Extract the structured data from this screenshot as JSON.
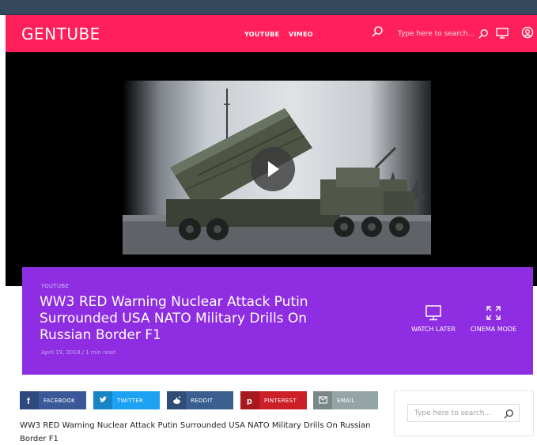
{
  "header": {
    "brand": "GENTUBE",
    "nav": [
      "YOUTUBE",
      "VIMEO"
    ],
    "search_placeholder": "Type here to search...",
    "icons": [
      "search-icon",
      "monitor-icon",
      "user-icon"
    ],
    "bg_color": "#ff1f5a"
  },
  "video": {
    "play_icon": "play-icon"
  },
  "info": {
    "category": "YOUTUBE",
    "title": "WW3 RED Warning Nuclear Attack Putin Surrounded USA NATO Military Drills On Russian Border F1",
    "meta": "April 19, 2018 / 1 min read",
    "watch_later": "WATCH LATER",
    "cinema_mode": "CINEMA MODE",
    "bg_color": "#8e2de2"
  },
  "share": {
    "facebook": "FACEBOOK",
    "twitter": "TWITTER",
    "reddit": "REDDIT",
    "pinterest": "PINTEREST",
    "email": "EMAIL"
  },
  "description": "WW3 RED Warning Nuclear Attack Putin Surrounded USA NATO Military Drills On Russian Border F1",
  "sidebar": {
    "search_placeholder": "Type here to search..."
  }
}
